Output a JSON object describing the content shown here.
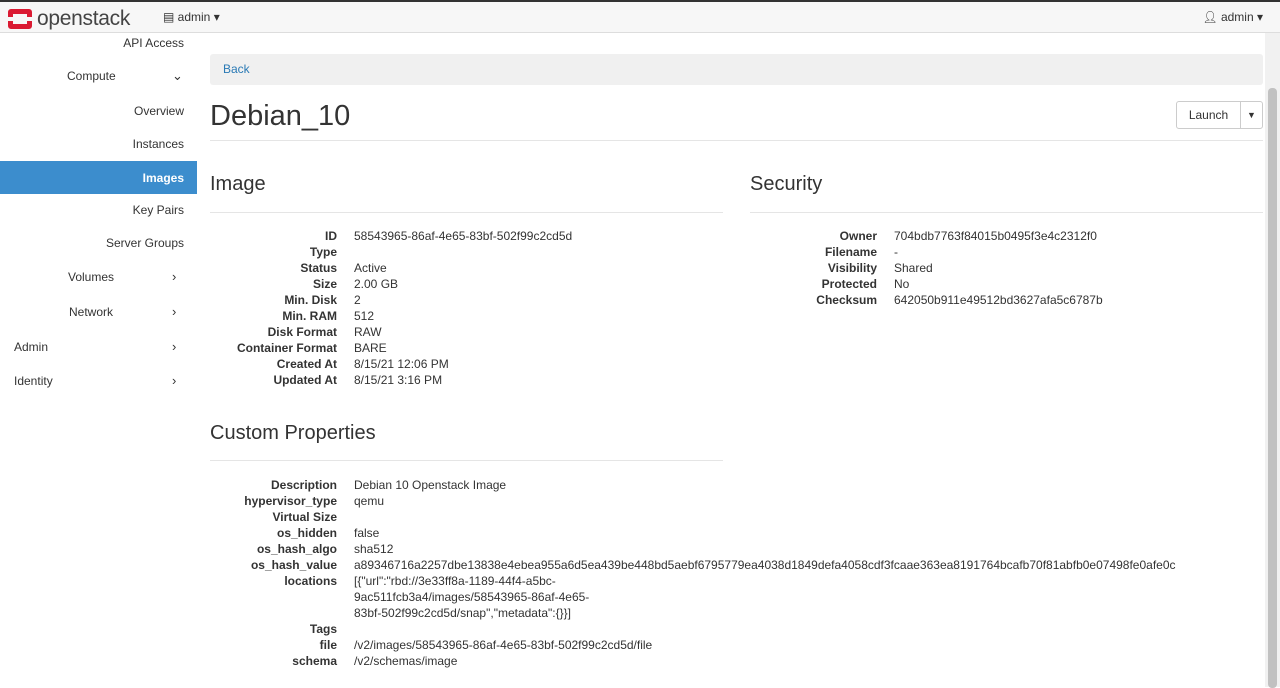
{
  "topbar": {
    "brand": "openstack",
    "project": "admin",
    "user": "admin"
  },
  "sidebar": {
    "items": [
      {
        "label": "API Access"
      },
      {
        "label": "Compute"
      },
      {
        "label": "Overview"
      },
      {
        "label": "Instances"
      },
      {
        "label": "Images"
      },
      {
        "label": "Key Pairs"
      },
      {
        "label": "Server Groups"
      },
      {
        "label": "Volumes"
      },
      {
        "label": "Network"
      },
      {
        "label": "Admin"
      },
      {
        "label": "Identity"
      }
    ]
  },
  "main": {
    "back": "Back",
    "title": "Debian_10",
    "launch": "Launch",
    "image": {
      "heading": "Image",
      "rows": [
        {
          "k": "ID",
          "v": "58543965-86af-4e65-83bf-502f99c2cd5d"
        },
        {
          "k": "Type",
          "v": ""
        },
        {
          "k": "Status",
          "v": "Active"
        },
        {
          "k": "Size",
          "v": "2.00 GB"
        },
        {
          "k": "Min. Disk",
          "v": "2"
        },
        {
          "k": "Min. RAM",
          "v": "512"
        },
        {
          "k": "Disk Format",
          "v": "RAW"
        },
        {
          "k": "Container Format",
          "v": "BARE"
        },
        {
          "k": "Created At",
          "v": "8/15/21 12:06 PM"
        },
        {
          "k": "Updated At",
          "v": "8/15/21 3:16 PM"
        }
      ]
    },
    "security": {
      "heading": "Security",
      "rows": [
        {
          "k": "Owner",
          "v": "704bdb7763f84015b0495f3e4c2312f0"
        },
        {
          "k": "Filename",
          "v": "-"
        },
        {
          "k": "Visibility",
          "v": "Shared"
        },
        {
          "k": "Protected",
          "v": "No"
        },
        {
          "k": "Checksum",
          "v": "642050b911e49512bd3627afa5c6787b"
        }
      ]
    },
    "custom": {
      "heading": "Custom Properties",
      "rows": [
        {
          "k": "Description",
          "v": "Debian 10 Openstack Image"
        },
        {
          "k": "hypervisor_type",
          "v": "qemu"
        },
        {
          "k": "Virtual Size",
          "v": ""
        },
        {
          "k": "os_hidden",
          "v": "false"
        },
        {
          "k": "os_hash_algo",
          "v": "sha512"
        },
        {
          "k": "os_hash_value",
          "v": "a89346716a2257dbe13838e4ebea955a6d5ea439be448bd5aebf6795779ea4038d1849defa4058cdf3fcaae363ea8191764bcafb70f81abfb0e07498fe0afe0c"
        },
        {
          "k": "locations",
          "v": "[{\"url\":\"rbd://3e33ff8a-1189-44f4-a5bc-9ac511fcb3a4/images/58543965-86af-4e65-83bf-502f99c2cd5d/snap\",\"metadata\":{}}]"
        },
        {
          "k": "Tags",
          "v": ""
        },
        {
          "k": "file",
          "v": "/v2/images/58543965-86af-4e65-83bf-502f99c2cd5d/file"
        },
        {
          "k": "schema",
          "v": "/v2/schemas/image"
        }
      ]
    }
  }
}
